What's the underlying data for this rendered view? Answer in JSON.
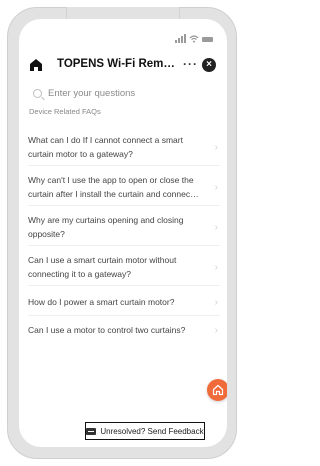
{
  "header": {
    "title": "TOPENS Wi-Fi Remo...",
    "more_label": "···",
    "close_label": "×"
  },
  "search": {
    "placeholder": "Enter your questions"
  },
  "section": {
    "label": "Device Related FAQs"
  },
  "faqs": [
    {
      "line1": "What can I do If I cannot connect a smart",
      "line2": "curtain motor to a gateway?"
    },
    {
      "line1": "Why can't I use the app to open or close the",
      "line2": "curtain after I install the curtain and connect I..."
    },
    {
      "line1": "Why are my curtains opening and closing",
      "line2": "opposite?"
    },
    {
      "line1": "Can I use a smart curtain motor without",
      "line2": "connecting it to a gateway?"
    },
    {
      "line1": "How do I power a smart curtain motor?",
      "line2": ""
    },
    {
      "line1": "Can I use a motor to control two curtains?",
      "line2": ""
    }
  ],
  "chevron": "›",
  "feedback": {
    "label": "Unresolved? Send Feedback"
  },
  "colors": {
    "accent": "#f06a3a"
  }
}
